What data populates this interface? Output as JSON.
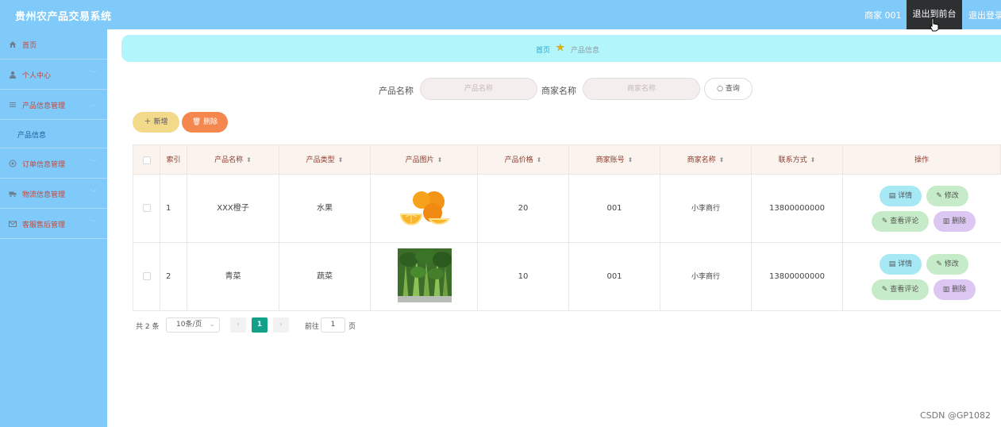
{
  "header": {
    "title": "贵州农产品交易系统",
    "user_label": "商家 001",
    "front_button": "退出到前台",
    "logout_button": "退出登录"
  },
  "sidebar": {
    "items": [
      {
        "label": "首页",
        "icon": "home-icon"
      },
      {
        "label": "个人中心",
        "icon": "user-icon"
      },
      {
        "label": "产品信息管理",
        "icon": "list-icon"
      },
      {
        "label": "产品信息",
        "sub": true
      },
      {
        "label": "订单信息管理",
        "icon": "order-icon"
      },
      {
        "label": "物流信息管理",
        "icon": "truck-icon"
      },
      {
        "label": "客服售后管理",
        "icon": "mail-icon"
      }
    ]
  },
  "breadcrumb": {
    "home": "首页",
    "current": "产品信息"
  },
  "search": {
    "product_label": "产品名称",
    "product_placeholder": "产品名称",
    "merchant_label": "商家名称",
    "merchant_placeholder": "商家名称",
    "query_button": "查询"
  },
  "toolbar": {
    "add_label": "新增",
    "delete_label": "删除"
  },
  "table": {
    "columns": [
      "索引",
      "产品名称",
      "产品类型",
      "产品图片",
      "产品价格",
      "商家账号",
      "商家名称",
      "联系方式",
      "操作"
    ],
    "rows": [
      {
        "index": "1",
        "name": "XXX橙子",
        "type": "水果",
        "image": "orange",
        "price": "20",
        "account": "001",
        "merchant": "小李商行",
        "phone": "13800000000"
      },
      {
        "index": "2",
        "name": "青菜",
        "type": "蔬菜",
        "image": "greens",
        "price": "10",
        "account": "001",
        "merchant": "小李商行",
        "phone": "13800000000"
      }
    ],
    "actions": {
      "detail": "详情",
      "edit": "修改",
      "review": "查看评论",
      "remove": "删除"
    }
  },
  "pagination": {
    "total": "共 2 条",
    "page_size": "10条/页",
    "current_page": "1",
    "goto_label": "前往",
    "goto_value": "1",
    "goto_unit": "页"
  },
  "watermark": "CSDN @GP1082",
  "colors": {
    "header_bg": "#7fcaf9",
    "sidebar_bg": "#7fcaf9",
    "breadcrumb_bg": "#b2f5fa",
    "page_active": "#13a089",
    "delete_bg": "#f4874e",
    "add_bg": "#f3d98a"
  }
}
